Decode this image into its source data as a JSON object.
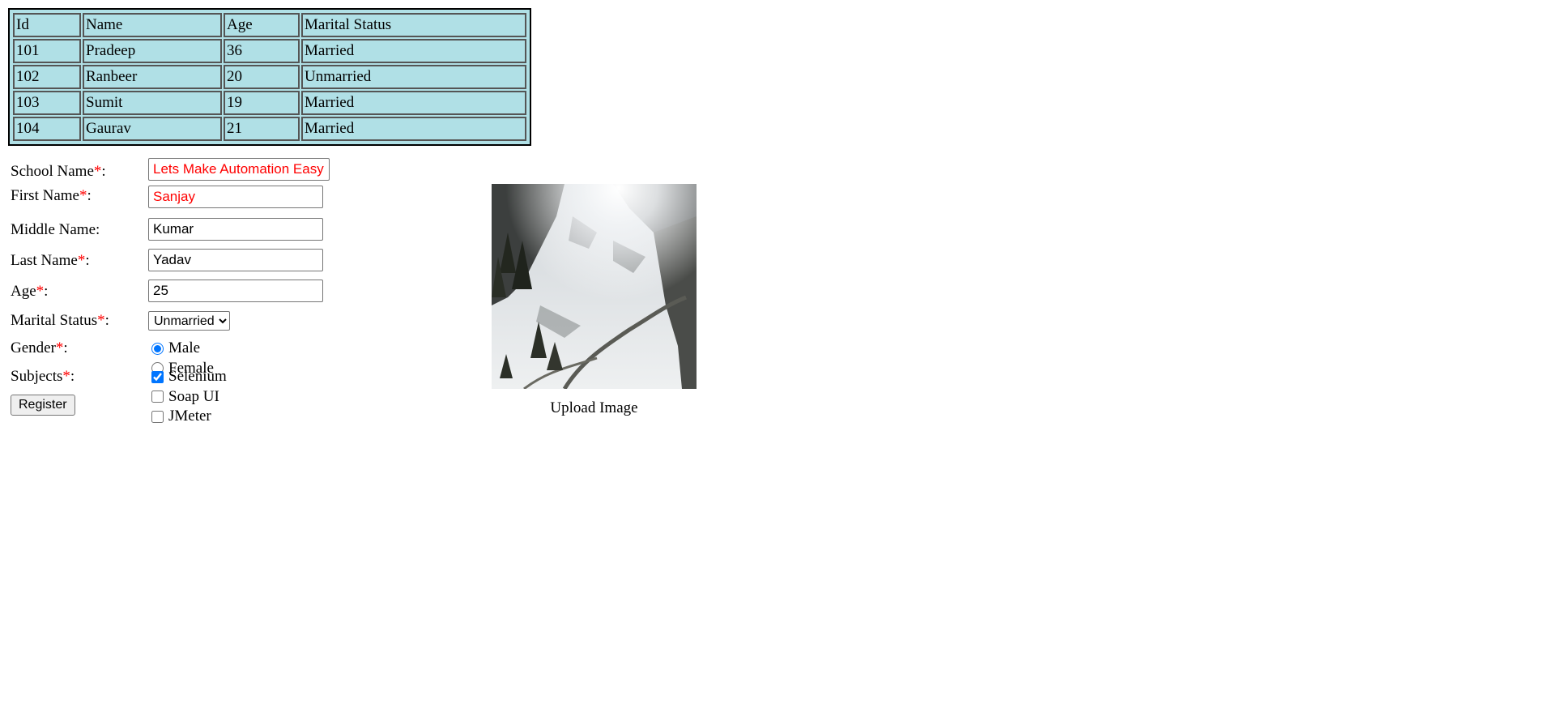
{
  "table": {
    "header": [
      "Id",
      "Name",
      "Age",
      "Marital Status"
    ],
    "rows": [
      [
        "101",
        "Pradeep",
        "36",
        "Married"
      ],
      [
        "102",
        "Ranbeer",
        "20",
        "Unmarried"
      ],
      [
        "103",
        "Sumit",
        "19",
        "Married"
      ],
      [
        "104",
        "Gaurav",
        "21",
        "Married"
      ]
    ]
  },
  "form": {
    "required_mark": "*",
    "school_name": {
      "label": "School Name",
      "value": "Lets Make Automation Easy"
    },
    "first_name": {
      "label": "First Name",
      "value": "Sanjay"
    },
    "middle_name": {
      "label": "Middle Name:",
      "value": "Kumar"
    },
    "last_name": {
      "label": "Last Name",
      "value": "Yadav"
    },
    "age": {
      "label": "Age",
      "value": "25"
    },
    "marital_status": {
      "label": "Marital Status",
      "selected": "Unmarried"
    },
    "gender": {
      "label": "Gender",
      "options": [
        "Male",
        "Female"
      ],
      "selected": "Male"
    },
    "subjects": {
      "label": "Subjects",
      "options": [
        "Selenium",
        "Soap UI",
        "JMeter"
      ],
      "checked": [
        "Selenium"
      ]
    },
    "register_label": "Register"
  },
  "image": {
    "caption": "Upload Image",
    "description_icon": "snowy-mountain-photo"
  }
}
